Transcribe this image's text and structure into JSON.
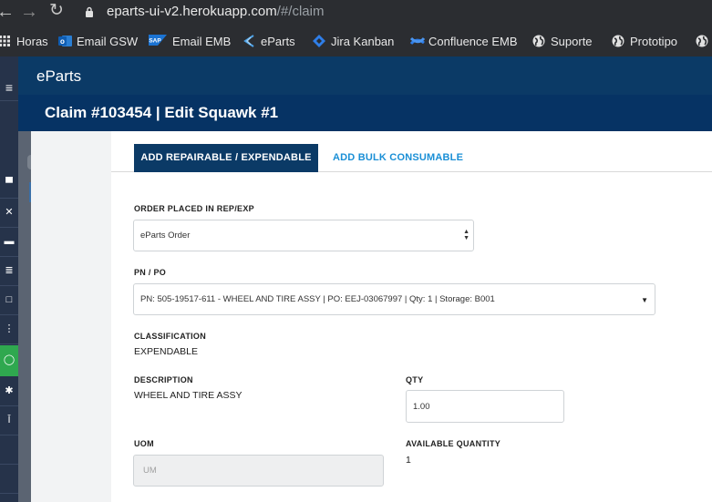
{
  "browser": {
    "url_host": "eparts-ui-v2.herokuapp.com",
    "url_path": "/#/claim",
    "bookmarks": [
      {
        "label": "Horas",
        "icon": "apps-icon"
      },
      {
        "label": "Email GSW",
        "icon": "outlook-icon"
      },
      {
        "label": "Email EMB",
        "icon": "sap-icon"
      },
      {
        "label": "eParts",
        "icon": "eparts-icon"
      },
      {
        "label": "Jira Kanban",
        "icon": "jira-icon"
      },
      {
        "label": "Confluence EMB",
        "icon": "confluence-icon"
      },
      {
        "label": "Suporte",
        "icon": "globe-icon"
      },
      {
        "label": "Prototipo",
        "icon": "globe-icon"
      }
    ]
  },
  "app": {
    "brand": "eParts",
    "page_title": "Claim #103454 | Edit Squawk #1"
  },
  "tabs": {
    "active": "ADD REPAIRABLE / EXPENDABLE",
    "inactive": "ADD BULK CONSUMABLE"
  },
  "form": {
    "order_placed_label": "ORDER PLACED IN REP/EXP",
    "order_placed_value": "eParts Order",
    "pn_po_label": "PN / PO",
    "pn_po_value": "PN: 505-19517-611 - WHEEL AND TIRE ASSY | PO: EEJ-03067997 | Qty: 1 | Storage: B001",
    "classification_label": "CLASSIFICATION",
    "classification_value": "EXPENDABLE",
    "description_label": "DESCRIPTION",
    "description_value": "WHEEL AND TIRE ASSY",
    "qty_label": "QTY",
    "qty_value": "1.00",
    "uom_label": "UOM",
    "uom_placeholder": "UM",
    "available_qty_label": "AVAILABLE QUANTITY",
    "available_qty_value": "1"
  },
  "colors": {
    "app_header": "#0b3a66",
    "title_bar": "#063364",
    "sidebar": "#26334a",
    "active_tab": "#0b3a66",
    "link_tab": "#1a8fd6",
    "sidebar_active": "#2fa84f"
  }
}
